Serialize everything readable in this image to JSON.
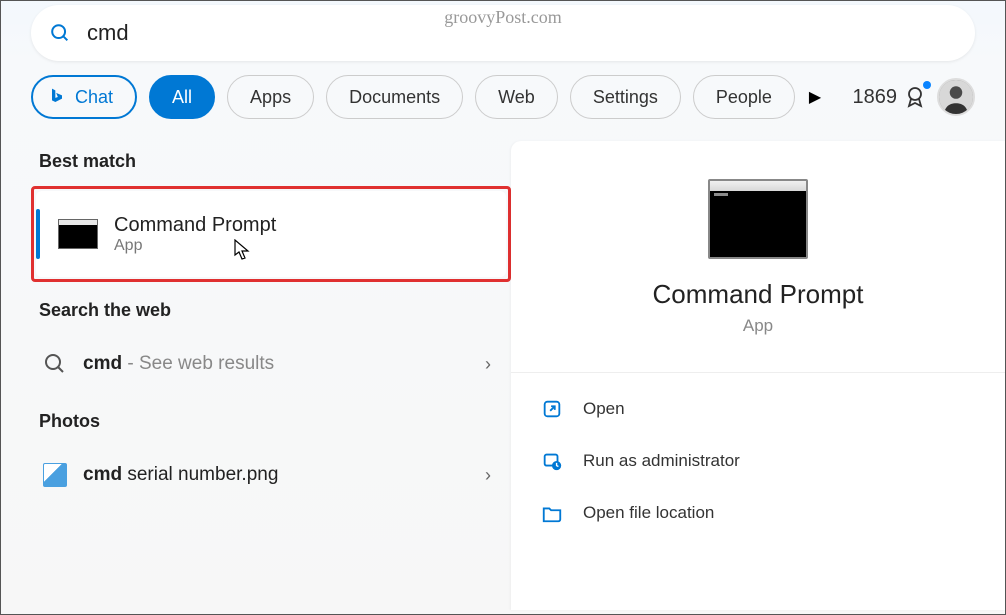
{
  "watermark": "groovyPost.com",
  "search": {
    "query": "cmd",
    "placeholder": ""
  },
  "filters": {
    "chat": "Chat",
    "all": "All",
    "apps": "Apps",
    "documents": "Documents",
    "web": "Web",
    "settings": "Settings",
    "people": "People"
  },
  "rewards": {
    "points": "1869"
  },
  "left": {
    "best_match_label": "Best match",
    "result_title": "Command Prompt",
    "result_sub": "App",
    "search_web_label": "Search the web",
    "web_query_bold": "cmd",
    "web_query_dim": " - See web results",
    "photos_label": "Photos",
    "photo_bold": "cmd",
    "photo_rest": " serial number.png"
  },
  "detail": {
    "title": "Command Prompt",
    "sub": "App",
    "actions": {
      "open": "Open",
      "admin": "Run as administrator",
      "location": "Open file location"
    }
  }
}
